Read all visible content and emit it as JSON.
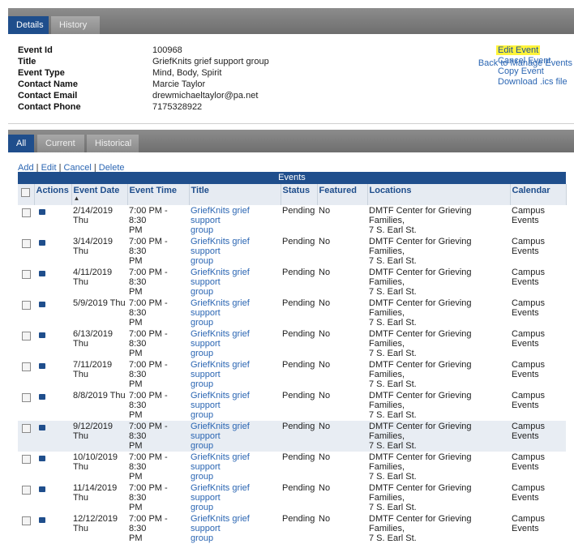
{
  "top_tabs": [
    {
      "label": "Details",
      "active": true
    },
    {
      "label": "History",
      "active": false
    }
  ],
  "back_link": "Back to Manage Events",
  "details": [
    {
      "label": "Event Id",
      "value": "100968"
    },
    {
      "label": "Title",
      "value": "GriefKnits grief support group"
    },
    {
      "label": "Event Type",
      "value": "Mind, Body, Spirit"
    },
    {
      "label": "Contact Name",
      "value": "Marcie Taylor"
    },
    {
      "label": "Contact Email",
      "value": "drewmichaeltaylor@pa.net"
    },
    {
      "label": "Contact Phone",
      "value": "7175328922"
    }
  ],
  "event_actions": {
    "edit": "Edit Event",
    "cancel": "Cancel Event",
    "copy": "Copy Event",
    "download": "Download .ics file",
    "highlight_color": "#fff33a"
  },
  "bottom_tabs": [
    {
      "label": "All",
      "active": true
    },
    {
      "label": "Current",
      "active": false
    },
    {
      "label": "Historical",
      "active": false
    }
  ],
  "toolbar": {
    "add": "Add",
    "edit": "Edit",
    "cancel": "Cancel",
    "delete": "Delete",
    "sep": "|"
  },
  "table": {
    "caption": "Events",
    "columns": [
      "Actions",
      "Event Date",
      "Event Time",
      "Title",
      "Status",
      "Featured",
      "Locations",
      "Calendar"
    ],
    "sort_indicator": "▲",
    "rows": [
      {
        "date": "2/14/2019",
        "day": "Thu",
        "time": "7:00 PM - 8:30",
        "time2": "PM",
        "title": "GriefKnits grief support",
        "title2": "group",
        "status": "Pending",
        "featured": "No",
        "loc": "DMTF Center for Grieving Families,",
        "loc2": "7 S. Earl St.",
        "cal": "Campus",
        "cal2": "Events"
      },
      {
        "date": "3/14/2019",
        "day": "Thu",
        "time": "7:00 PM - 8:30",
        "time2": "PM",
        "title": "GriefKnits grief support",
        "title2": "group",
        "status": "Pending",
        "featured": "No",
        "loc": "DMTF Center for Grieving Families,",
        "loc2": "7 S. Earl St.",
        "cal": "Campus",
        "cal2": "Events"
      },
      {
        "date": "4/11/2019 Thu",
        "day": "",
        "time": "7:00 PM - 8:30",
        "time2": "PM",
        "title": "GriefKnits grief support",
        "title2": "group",
        "status": "Pending",
        "featured": "No",
        "loc": "DMTF Center for Grieving Families,",
        "loc2": "7 S. Earl St.",
        "cal": "Campus",
        "cal2": "Events"
      },
      {
        "date": "5/9/2019 Thu",
        "day": "",
        "time": "7:00 PM - 8:30",
        "time2": "PM",
        "title": "GriefKnits grief support",
        "title2": "group",
        "status": "Pending",
        "featured": "No",
        "loc": "DMTF Center for Grieving Families,",
        "loc2": "7 S. Earl St.",
        "cal": "Campus",
        "cal2": "Events"
      },
      {
        "date": "6/13/2019",
        "day": "Thu",
        "time": "7:00 PM - 8:30",
        "time2": "PM",
        "title": "GriefKnits grief support",
        "title2": "group",
        "status": "Pending",
        "featured": "No",
        "loc": "DMTF Center for Grieving Families,",
        "loc2": "7 S. Earl St.",
        "cal": "Campus",
        "cal2": "Events"
      },
      {
        "date": "7/11/2019 Thu",
        "day": "",
        "time": "7:00 PM - 8:30",
        "time2": "PM",
        "title": "GriefKnits grief support",
        "title2": "group",
        "status": "Pending",
        "featured": "No",
        "loc": "DMTF Center for Grieving Families,",
        "loc2": "7 S. Earl St.",
        "cal": "Campus",
        "cal2": "Events"
      },
      {
        "date": "8/8/2019 Thu",
        "day": "",
        "time": "7:00 PM - 8:30",
        "time2": "PM",
        "title": "GriefKnits grief support",
        "title2": "group",
        "status": "Pending",
        "featured": "No",
        "loc": "DMTF Center for Grieving Families,",
        "loc2": "7 S. Earl St.",
        "cal": "Campus",
        "cal2": "Events"
      },
      {
        "date": "9/12/2019",
        "day": "Thu",
        "time": "7:00 PM - 8:30",
        "time2": "PM",
        "title": "GriefKnits grief support",
        "title2": "group",
        "status": "Pending",
        "featured": "No",
        "loc": "DMTF Center for Grieving Families,",
        "loc2": "7 S. Earl St.",
        "cal": "Campus",
        "cal2": "Events"
      },
      {
        "date": "10/10/2019",
        "day": "Thu",
        "time": "7:00 PM - 8:30",
        "time2": "PM",
        "title": "GriefKnits grief support",
        "title2": "group",
        "status": "Pending",
        "featured": "No",
        "loc": "DMTF Center for Grieving Families,",
        "loc2": "7 S. Earl St.",
        "cal": "Campus",
        "cal2": "Events"
      },
      {
        "date": "11/14/2019",
        "day": "Thu",
        "time": "7:00 PM - 8:30",
        "time2": "PM",
        "title": "GriefKnits grief support",
        "title2": "group",
        "status": "Pending",
        "featured": "No",
        "loc": "DMTF Center for Grieving Families,",
        "loc2": "7 S. Earl St.",
        "cal": "Campus",
        "cal2": "Events"
      },
      {
        "date": "12/12/2019",
        "day": "Thu",
        "time": "7:00 PM - 8:30",
        "time2": "PM",
        "title": "GriefKnits grief support",
        "title2": "group",
        "status": "Pending",
        "featured": "No",
        "loc": "DMTF Center for Grieving Families,",
        "loc2": "7 S. Earl St.",
        "cal": "Campus",
        "cal2": "Events"
      }
    ]
  },
  "colors": {
    "accent": "#1f4e8c",
    "link": "#2b66b3",
    "row_alt": "#e8edf3"
  }
}
